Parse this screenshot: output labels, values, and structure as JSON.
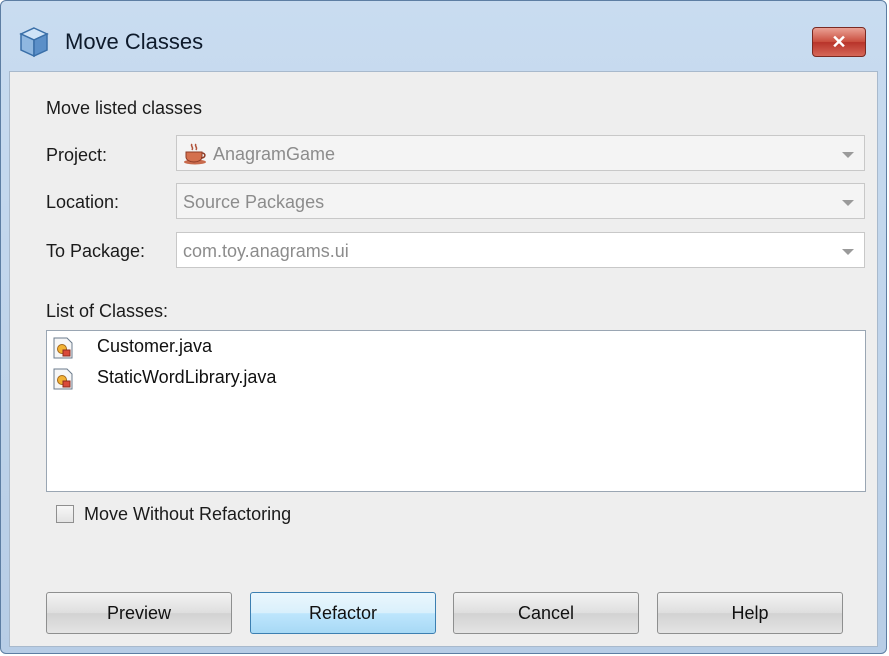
{
  "window": {
    "title": "Move Classes",
    "close_label": "✕"
  },
  "form": {
    "heading": "Move listed classes",
    "project_label": "Project:",
    "project_value": "AnagramGame",
    "location_label": "Location:",
    "location_value": "Source Packages",
    "package_label": "To Package:",
    "package_value": "com.toy.anagrams.ui",
    "list_label": "List of Classes:",
    "classes": [
      {
        "name": "Customer.java"
      },
      {
        "name": "StaticWordLibrary.java"
      }
    ],
    "checkbox_label": "Move Without Refactoring",
    "checkbox_checked": false
  },
  "buttons": {
    "preview": "Preview",
    "refactor": "Refactor",
    "cancel": "Cancel",
    "help": "Help"
  },
  "colors": {
    "titlebar": "#c9dcf0",
    "close_button": "#c94c3c",
    "default_button": "#bee6fd"
  },
  "icons": {
    "window": "cube-icon",
    "project": "coffee-cup-icon",
    "class_file": "java-class-file-icon",
    "dropdown": "chevron-down-icon"
  }
}
